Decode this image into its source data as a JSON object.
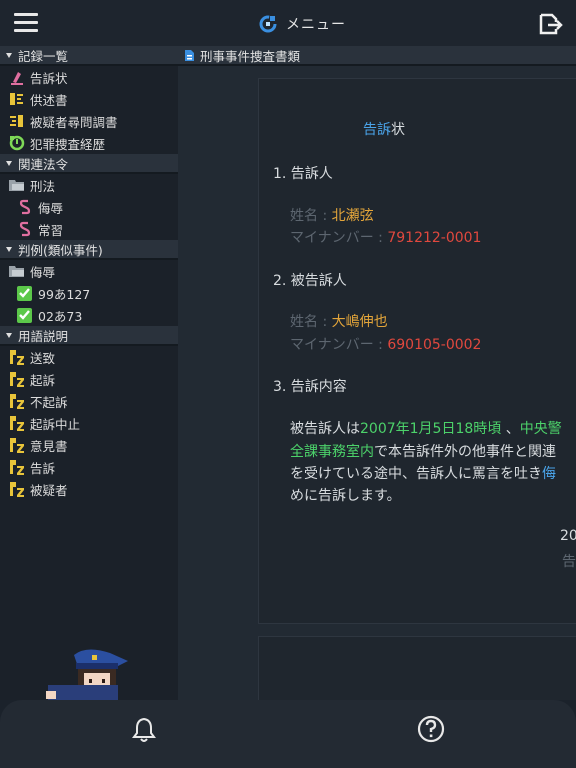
{
  "header": {
    "title": "メニュー",
    "menu_icon": "hamburger-icon",
    "title_icon": "refresh-icon",
    "export_icon": "export-icon"
  },
  "sidebar": {
    "sections": [
      {
        "label": "記録一覧",
        "items": [
          {
            "label": "告訴状",
            "icon": "pen-icon",
            "color": "#e06fa0"
          },
          {
            "label": "供述書",
            "icon": "statement-icon",
            "color": "#e8c43a"
          },
          {
            "label": "被疑者尋問調書",
            "icon": "interrogation-icon",
            "color": "#e8c43a"
          },
          {
            "label": "犯罪捜査経歴",
            "icon": "history-icon",
            "color": "#7ed957"
          }
        ]
      },
      {
        "label": "関連法令",
        "items": [
          {
            "label": "刑法",
            "icon": "folder-icon",
            "level": 0
          },
          {
            "label": "侮辱",
            "icon": "section-icon",
            "level": 1
          },
          {
            "label": "常習",
            "icon": "section-icon",
            "level": 1
          }
        ]
      },
      {
        "label": "判例(類似事件)",
        "items": [
          {
            "label": "侮辱",
            "icon": "folder-icon",
            "level": 0
          },
          {
            "label": "99あ127",
            "icon": "check-icon",
            "level": 1
          },
          {
            "label": "02あ73",
            "icon": "check-icon",
            "level": 1
          }
        ]
      },
      {
        "label": "用語説明",
        "items": [
          {
            "label": "送致",
            "icon": "term-icon"
          },
          {
            "label": "起訴",
            "icon": "term-icon"
          },
          {
            "label": "不起訴",
            "icon": "term-icon"
          },
          {
            "label": "起訴中止",
            "icon": "term-icon"
          },
          {
            "label": "意見書",
            "icon": "term-icon"
          },
          {
            "label": "告訴",
            "icon": "term-icon"
          },
          {
            "label": "被疑者",
            "icon": "term-icon"
          }
        ]
      }
    ]
  },
  "main": {
    "tab_label": "刑事事件捜査書類",
    "document": {
      "title_highlight": "告訴",
      "title_rest": "状",
      "sec1": "1. 告訴人",
      "name_key": "姓名 : ",
      "complainant_name": "北瀬弦",
      "mynumber_key": "マイナンバー : ",
      "complainant_number": "791212-0001",
      "sec2": "2. 被告訴人",
      "accused_name": "大嶋伸也",
      "accused_number": "690105-0002",
      "sec3": "3. 告訴内容",
      "line1_a": "被告訴人は",
      "line1_b": "2007年1月5日18時頃",
      "line1_c": " 、",
      "line1_d": "中央警",
      "line2_a": "全課事務室内",
      "line2_b": "で本告訴件外の他事件と関連",
      "line3_a": "を受けている途中、告訴人に罵言を吐き",
      "line3_b": "侮",
      "line4": "めに告訴します。",
      "date_fragment": "20",
      "signer_fragment": "告"
    }
  },
  "bottom": {
    "bell_icon": "bell-icon",
    "help_icon": "help-icon",
    "mascot": "police-officer-mascot"
  }
}
